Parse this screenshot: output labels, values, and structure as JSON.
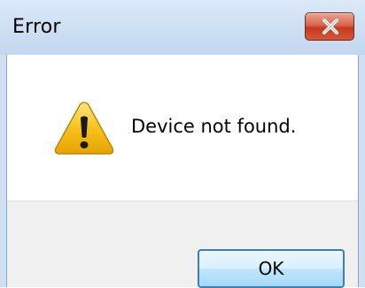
{
  "window": {
    "title": "Error",
    "close_icon": "close-x-icon"
  },
  "dialog": {
    "icon": "warning-icon",
    "message": "Device not found."
  },
  "buttons": {
    "ok_label": "OK"
  },
  "colors": {
    "titlebar": "#cddff3",
    "close_button": "#c7391c",
    "ok_border": "#3c7fb1",
    "button_area": "#f0f0f0",
    "warning_fill": "#f6c21c"
  }
}
